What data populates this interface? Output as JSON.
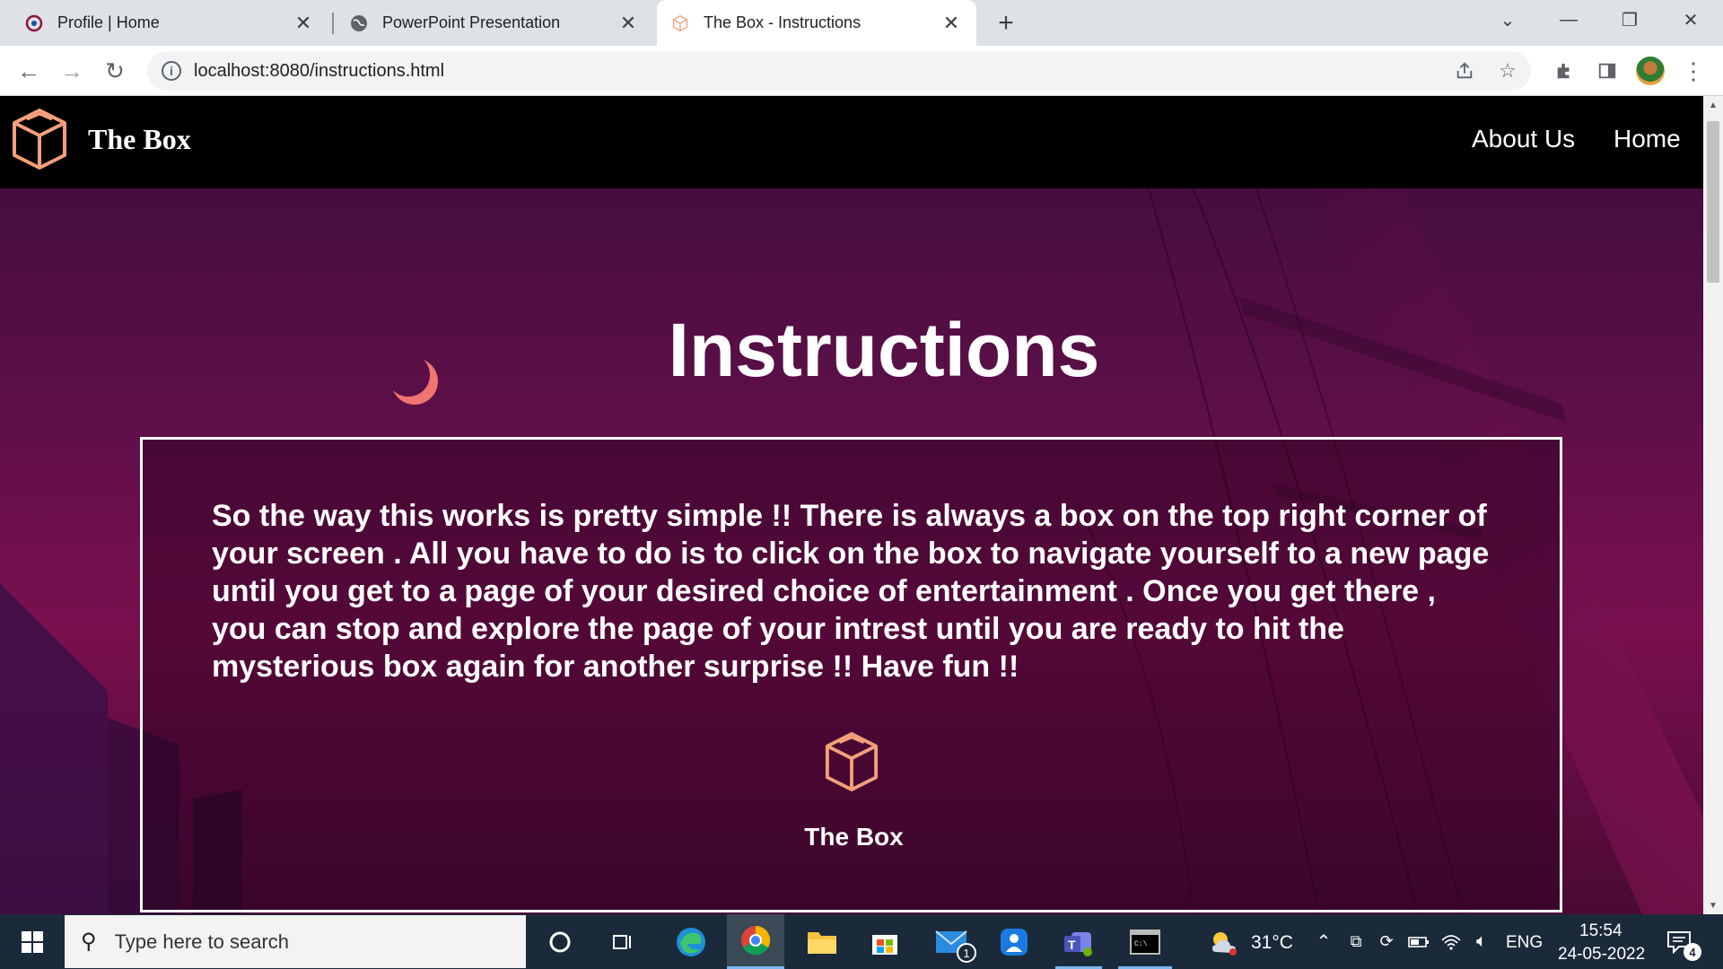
{
  "browser": {
    "tabs": [
      {
        "title": "Profile | Home",
        "icon": "profile-favicon"
      },
      {
        "title": "PowerPoint Presentation",
        "icon": "globe-favicon"
      },
      {
        "title": "The Box - Instructions",
        "icon": "box-favicon"
      }
    ],
    "url": "localhost:8080/instructions.html"
  },
  "site": {
    "brand": "The Box",
    "nav": {
      "about": "About Us",
      "home": "Home"
    },
    "page_title": "Instructions",
    "instructions": "So the way this works is pretty simple !! There is always a box on the top right corner of your screen . All you have to do is to click on the box to navigate yourself to a new page until you get to a page of your desired choice of entertainment . Once you get there , you can stop and explore the page of your intrest until you are ready to hit the mysterious box again for another surprise !! Have fun !!",
    "card_brand": "The Box",
    "accent": "#f4a07a"
  },
  "taskbar": {
    "search_placeholder": "Type here to search",
    "mail_badge": "1",
    "temperature": "31°C",
    "language": "ENG",
    "time": "15:54",
    "date": "24-05-2022",
    "notification_count": "4"
  }
}
